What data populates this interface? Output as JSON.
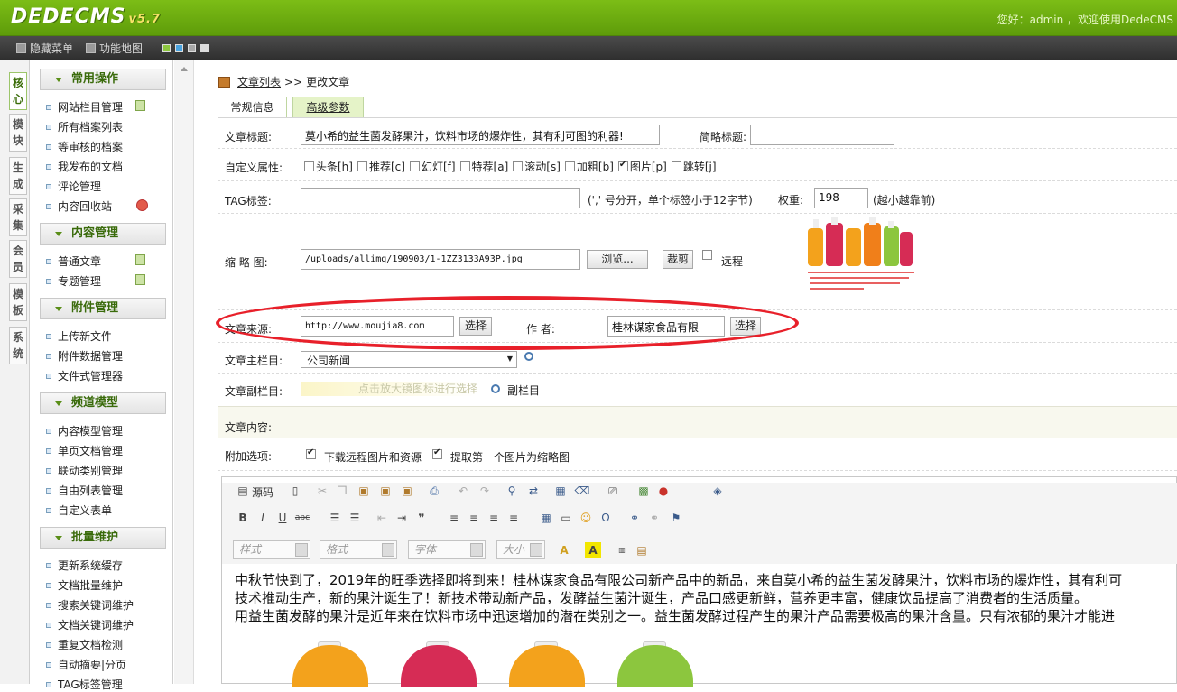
{
  "header": {
    "logo_text": "DEDECMS",
    "logo_version": "v5.7",
    "welcome": "您好：admin ，欢迎使用DedeCMS"
  },
  "menubar": {
    "hide_menu": "隐藏菜单",
    "site_map": "功能地图",
    "swatches": [
      "#8dc63f",
      "#4aa3df",
      "#a8a8a8",
      "#dddddd"
    ]
  },
  "vtabs": [
    "核心",
    "模块",
    "生成",
    "采集",
    "会员",
    "模板",
    "系统"
  ],
  "sidebar": {
    "sections": [
      {
        "title": "常用操作",
        "items": [
          "网站栏目管理",
          "所有档案列表",
          "等审核的档案",
          "我发布的文档",
          "评论管理",
          "内容回收站"
        ]
      },
      {
        "title": "内容管理",
        "items": [
          "普通文章",
          "专题管理"
        ]
      },
      {
        "title": "附件管理",
        "items": [
          "上传新文件",
          "附件数据管理",
          "文件式管理器"
        ]
      },
      {
        "title": "频道模型",
        "items": [
          "内容模型管理",
          "单页文档管理",
          "联动类别管理",
          "自由列表管理",
          "自定义表单"
        ]
      },
      {
        "title": "批量维护",
        "items": [
          "更新系统缓存",
          "文档批量维护",
          "搜索关键词维护",
          "文档关键词维护",
          "重复文档检测",
          "自动摘要|分页",
          "TAG标签管理"
        ]
      }
    ]
  },
  "breadcrumb": {
    "link": "文章列表",
    "sep": ">>",
    "current": "更改文章"
  },
  "tabs": {
    "basic": "常规信息",
    "advanced": "高级参数"
  },
  "form": {
    "title_label": "文章标题:",
    "title_value": "莫小希的益生菌发酵果汁，饮料市场的爆炸性，其有利可图的利器!",
    "short_title_label": "简略标题:",
    "short_title_value": "",
    "attr_label": "自定义属性:",
    "attrs": [
      {
        "label": "头条[h]",
        "checked": false
      },
      {
        "label": "推荐[c]",
        "checked": false
      },
      {
        "label": "幻灯[f]",
        "checked": false
      },
      {
        "label": "特荐[a]",
        "checked": false
      },
      {
        "label": "滚动[s]",
        "checked": false
      },
      {
        "label": "加粗[b]",
        "checked": false
      },
      {
        "label": "图片[p]",
        "checked": true
      },
      {
        "label": "跳转[j]",
        "checked": false
      }
    ],
    "tag_label": "TAG标签:",
    "tag_value": "",
    "tag_hint": "(',' 号分开，单个标签小于12字节)",
    "weight_label": "权重:",
    "weight_value": "198",
    "weight_hint": "(越小越靠前)",
    "thumb_label": "缩 略 图:",
    "thumb_value": "/uploads/allimg/190903/1-1ZZ3133A93P.jpg",
    "browse_btn": "浏览...",
    "crop_btn": "裁剪",
    "remote_label": "远程",
    "source_label": "文章来源:",
    "source_value": "http://www.moujia8.com",
    "select_btn": "选择",
    "author_label": "作  者:",
    "author_value": "桂林谋家食品有限",
    "main_cat_label": "文章主栏目:",
    "main_cat_value": "公司新闻",
    "sub_cat_label": "文章副栏目:",
    "sub_cat_hint": "点击放大镜图标进行选择",
    "sub_cat_btn": "副栏目",
    "content_label": "文章内容:",
    "extra_label": "附加选项:",
    "extra_opt1": "下载远程图片和资源",
    "extra_opt2": "提取第一个图片为缩略图"
  },
  "editor": {
    "source_btn": "源码",
    "style_combo": "样式",
    "format_combo": "格式",
    "font_combo": "字体",
    "size_combo": "大小",
    "body_lines": [
      "中秋节快到了，2019年的旺季选择即将到来！桂林谋家食品有限公司新产品中的新品，来自莫小希的益生菌发酵果汁，饮料市场的爆炸性，其有利可",
      "技术推动生产，新的果汁诞生了！新技术带动新产品，发酵益生菌汁诞生，产品口感更新鲜，营养更丰富，健康饮品提高了消费者的生活质量。",
      "用益生菌发酵的果汁是近年来在饮料市场中迅速增加的潜在类别之一。益生菌发酵过程产生的果汁产品需要极高的果汁含量。只有浓郁的果汁才能进"
    ]
  }
}
